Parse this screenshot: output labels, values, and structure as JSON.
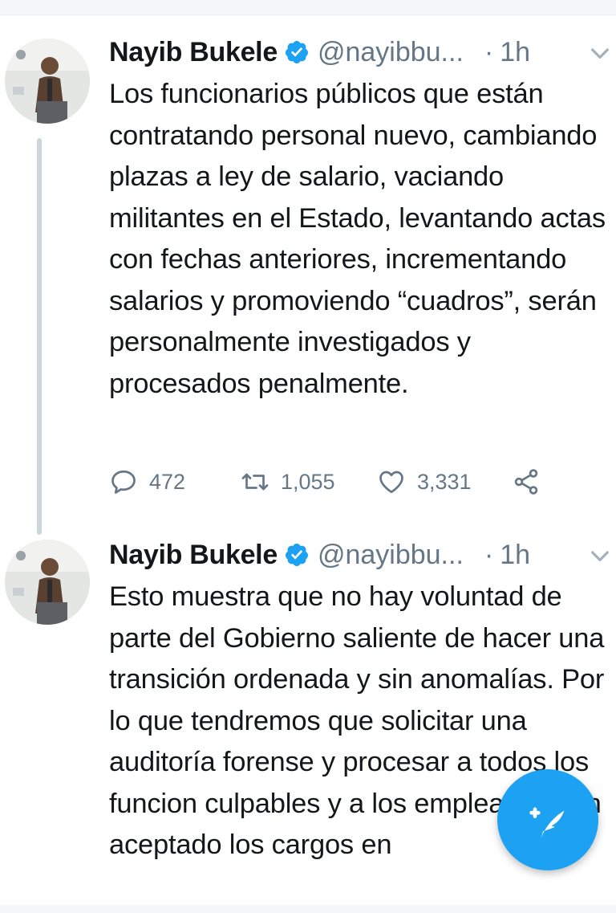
{
  "tweets": [
    {
      "name": "Nayib Bukele",
      "handle": "@nayibbu...",
      "separator": "·",
      "time": "1h",
      "text": "Los funcionarios públicos que están contratando personal nuevo, cambiando plazas a ley de salario, vaciando militantes en el Estado, levantando actas con fechas anteriores, incrementando salarios y promoviendo “cuadros”, serán personalmente investigados y procesados penalmente.",
      "replies": "472",
      "retweets": "1,055",
      "likes": "3,331"
    },
    {
      "name": "Nayib Bukele",
      "handle": "@nayibbu...",
      "separator": "·",
      "time": "1h",
      "text": "Esto muestra que no hay voluntad de parte del Gobierno saliente de hacer una transición ordenada y sin anomalías. Por lo que tendremos que solicitar una auditoría forense y procesar a todos los funcion culpables y a los empleados han aceptado los cargos en"
    }
  ],
  "icons": {
    "verified": "verified-badge-icon",
    "menu": "chevron-down-icon",
    "reply": "reply-icon",
    "retweet": "retweet-icon",
    "like": "heart-icon",
    "share": "share-icon",
    "compose": "compose-tweet-icon"
  },
  "colors": {
    "accent": "#1da1f2",
    "secondary_text": "#657786",
    "text": "#14171a"
  }
}
